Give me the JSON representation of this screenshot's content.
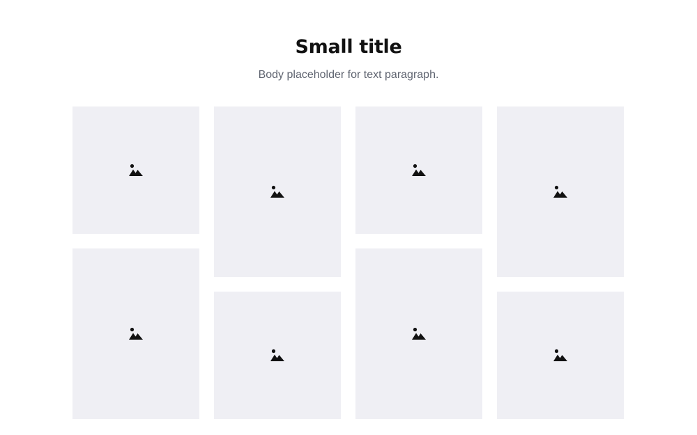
{
  "header": {
    "title": "Small title",
    "subtitle": "Body placeholder for text paragraph."
  },
  "gallery": {
    "placeholder_icon": "image-icon",
    "tile_color": "#efeff4",
    "columns": [
      {
        "tiles": [
          "square",
          "tall"
        ]
      },
      {
        "tiles": [
          "tall",
          "square"
        ]
      },
      {
        "tiles": [
          "square",
          "tall"
        ]
      },
      {
        "tiles": [
          "tall",
          "square"
        ]
      }
    ]
  }
}
